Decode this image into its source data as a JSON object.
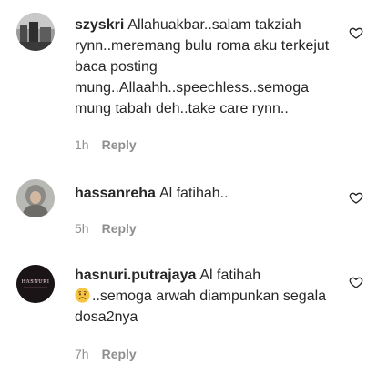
{
  "comments": [
    {
      "username": "szyskri",
      "text": "Allahuakbar..salam takziah rynn..meremang bulu roma aku terkejut baca posting mung..Allaahh..speechless..semoga mung tabah deh..take care rynn..",
      "time": "1h",
      "reply_label": "Reply",
      "like_icon": "heart-outline-icon"
    },
    {
      "username": "hassanreha",
      "text": "Al fatihah..",
      "time": "5h",
      "reply_label": "Reply",
      "like_icon": "heart-outline-icon"
    },
    {
      "username": "hasnuri.putrajaya",
      "text_before": "Al fatihah",
      "emoji_icon": "sad-face-emoji",
      "text_after": "..semoga arwah diampunkan segala dosa2nya",
      "avatar_logo": "HASNURI",
      "time": "7h",
      "reply_label": "Reply",
      "like_icon": "heart-outline-icon"
    }
  ],
  "colors": {
    "text": "#262626",
    "secondary": "#8e8e8e",
    "background": "#ffffff"
  }
}
